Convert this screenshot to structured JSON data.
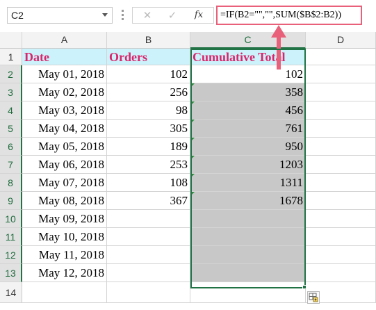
{
  "formula_bar": {
    "name_box": "C2",
    "cancel_glyph": "✕",
    "enter_glyph": "✓",
    "fx_label": "fx",
    "formula": "=IF(B2=\"\",\"\",SUM($B$2:B2))"
  },
  "columns": [
    "A",
    "B",
    "C",
    "D"
  ],
  "rows": [
    "1",
    "2",
    "3",
    "4",
    "5",
    "6",
    "7",
    "8",
    "9",
    "10",
    "11",
    "12",
    "13",
    "14"
  ],
  "header": {
    "date": "Date",
    "orders": "Orders",
    "cumulative": "Cumulative Total"
  },
  "data": [
    {
      "date": "May 01, 2018",
      "orders": "102",
      "total": "102"
    },
    {
      "date": "May 02, 2018",
      "orders": "256",
      "total": "358"
    },
    {
      "date": "May 03, 2018",
      "orders": "98",
      "total": "456"
    },
    {
      "date": "May 04, 2018",
      "orders": "305",
      "total": "761"
    },
    {
      "date": "May 05, 2018",
      "orders": "189",
      "total": "950"
    },
    {
      "date": "May 06, 2018",
      "orders": "253",
      "total": "1203"
    },
    {
      "date": "May 07, 2018",
      "orders": "108",
      "total": "1311"
    },
    {
      "date": "May 08, 2018",
      "orders": "367",
      "total": "1678"
    },
    {
      "date": "May 09, 2018",
      "orders": "",
      "total": ""
    },
    {
      "date": "May 10, 2018",
      "orders": "",
      "total": ""
    },
    {
      "date": "May 11, 2018",
      "orders": "",
      "total": ""
    },
    {
      "date": "May 12, 2018",
      "orders": "",
      "total": ""
    }
  ],
  "icons": {
    "quick_analysis": "quick-analysis-icon",
    "error_indicator": "error-indicator-icon"
  },
  "colors": {
    "header_fill": "#ccf2fb",
    "header_text": "#d9256b",
    "selected_fill": "#c8c8c8",
    "highlight": "#e8607a",
    "selection_border": "#217346"
  }
}
